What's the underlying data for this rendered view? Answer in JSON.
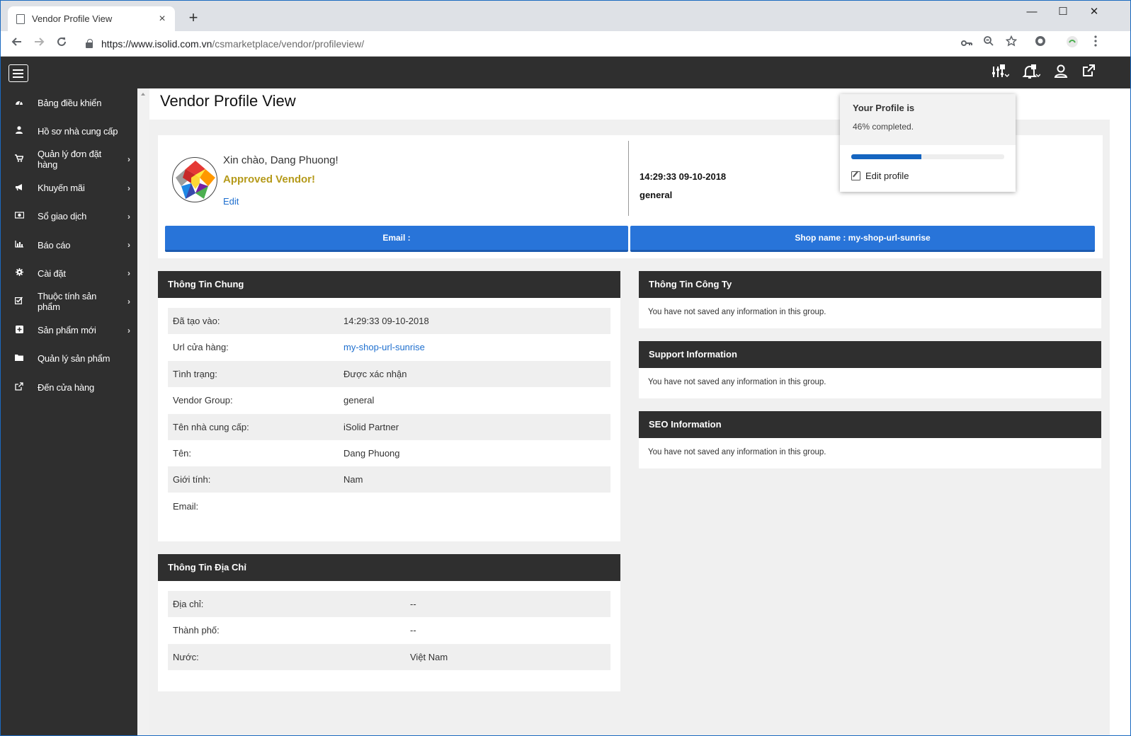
{
  "browser": {
    "tab_title": "Vendor Profile View",
    "tab_close": "×",
    "new_tab": "+",
    "url_host": "https://www.isolid.com.vn",
    "url_path": "/csmarketplace/vendor/profileview/",
    "window_controls": [
      "—",
      "☐",
      "✕"
    ]
  },
  "sidebar": {
    "items": [
      {
        "label": "Bảng điều khiển",
        "icon": "dashboard-icon",
        "arrow": false
      },
      {
        "label": "Hồ sơ nhà cung cấp",
        "icon": "user-icon",
        "arrow": false
      },
      {
        "label": "Quản lý đơn đặt hàng",
        "icon": "cart-icon",
        "arrow": true
      },
      {
        "label": "Khuyến mãi",
        "icon": "megaphone-icon",
        "arrow": true
      },
      {
        "label": "Sổ giao dịch",
        "icon": "money-icon",
        "arrow": true
      },
      {
        "label": "Báo cáo",
        "icon": "bar-chart-icon",
        "arrow": true
      },
      {
        "label": "Cài đặt",
        "icon": "gear-icon",
        "arrow": true
      },
      {
        "label": "Thuộc tính sản phẩm",
        "icon": "checkbox-icon",
        "arrow": true
      },
      {
        "label": "Sản phẩm mới",
        "icon": "plus-square-icon",
        "arrow": true
      },
      {
        "label": "Quản lý sản phẩm",
        "icon": "folder-icon",
        "arrow": false
      },
      {
        "label": "Đến cửa hàng",
        "icon": "external-link-icon",
        "arrow": false
      }
    ],
    "arrow_glyph": "›"
  },
  "page": {
    "title": "Vendor Profile View"
  },
  "profile": {
    "greeting": "Xin chào, Dang Phuong!",
    "status": "Approved Vendor!",
    "edit": "Edit",
    "created_at": "14:29:33 09-10-2018",
    "group": "general",
    "email_button": "Email :",
    "shop_button": "Shop name : my-shop-url-sunrise"
  },
  "general_info": {
    "title": "Thông Tin Chung",
    "rows": [
      {
        "k": "Đã tạo vào:",
        "v": "14:29:33 09-10-2018"
      },
      {
        "k": "Url cửa hàng:",
        "v": "my-shop-url-sunrise"
      },
      {
        "k": "Tình trạng:",
        "v": "Được xác nhận"
      },
      {
        "k": "Vendor Group:",
        "v": "general"
      },
      {
        "k": "Tên nhà cung cấp:",
        "v": "iSolid Partner"
      },
      {
        "k": "Tên:",
        "v": "Dang Phuong"
      },
      {
        "k": "Giới tính:",
        "v": "Nam"
      },
      {
        "k": "Email:",
        "v": ""
      }
    ]
  },
  "address_info": {
    "title": "Thông Tin Địa Chỉ",
    "rows": [
      {
        "k": "Địa chỉ:",
        "v": "--"
      },
      {
        "k": "Thành phố:",
        "v": "--"
      },
      {
        "k": "Nước:",
        "v": "Việt Nam"
      }
    ]
  },
  "company_info": {
    "title": "Thông Tin Công Ty",
    "message": "You have not saved any information in this group."
  },
  "support_info": {
    "title": "Support Information",
    "message": "You have not saved any information in this group."
  },
  "seo_info": {
    "title": "SEO Information",
    "message": "You have not saved any information in this group."
  },
  "dropdown": {
    "heading": "Your Profile is",
    "percent_text": "46% completed.",
    "progress": 0.46,
    "edit_profile": "Edit profile"
  },
  "colors": {
    "sidebar_bg": "#2f2f2f",
    "accent_blue": "#2874d9",
    "approved": "#b59a1a"
  }
}
